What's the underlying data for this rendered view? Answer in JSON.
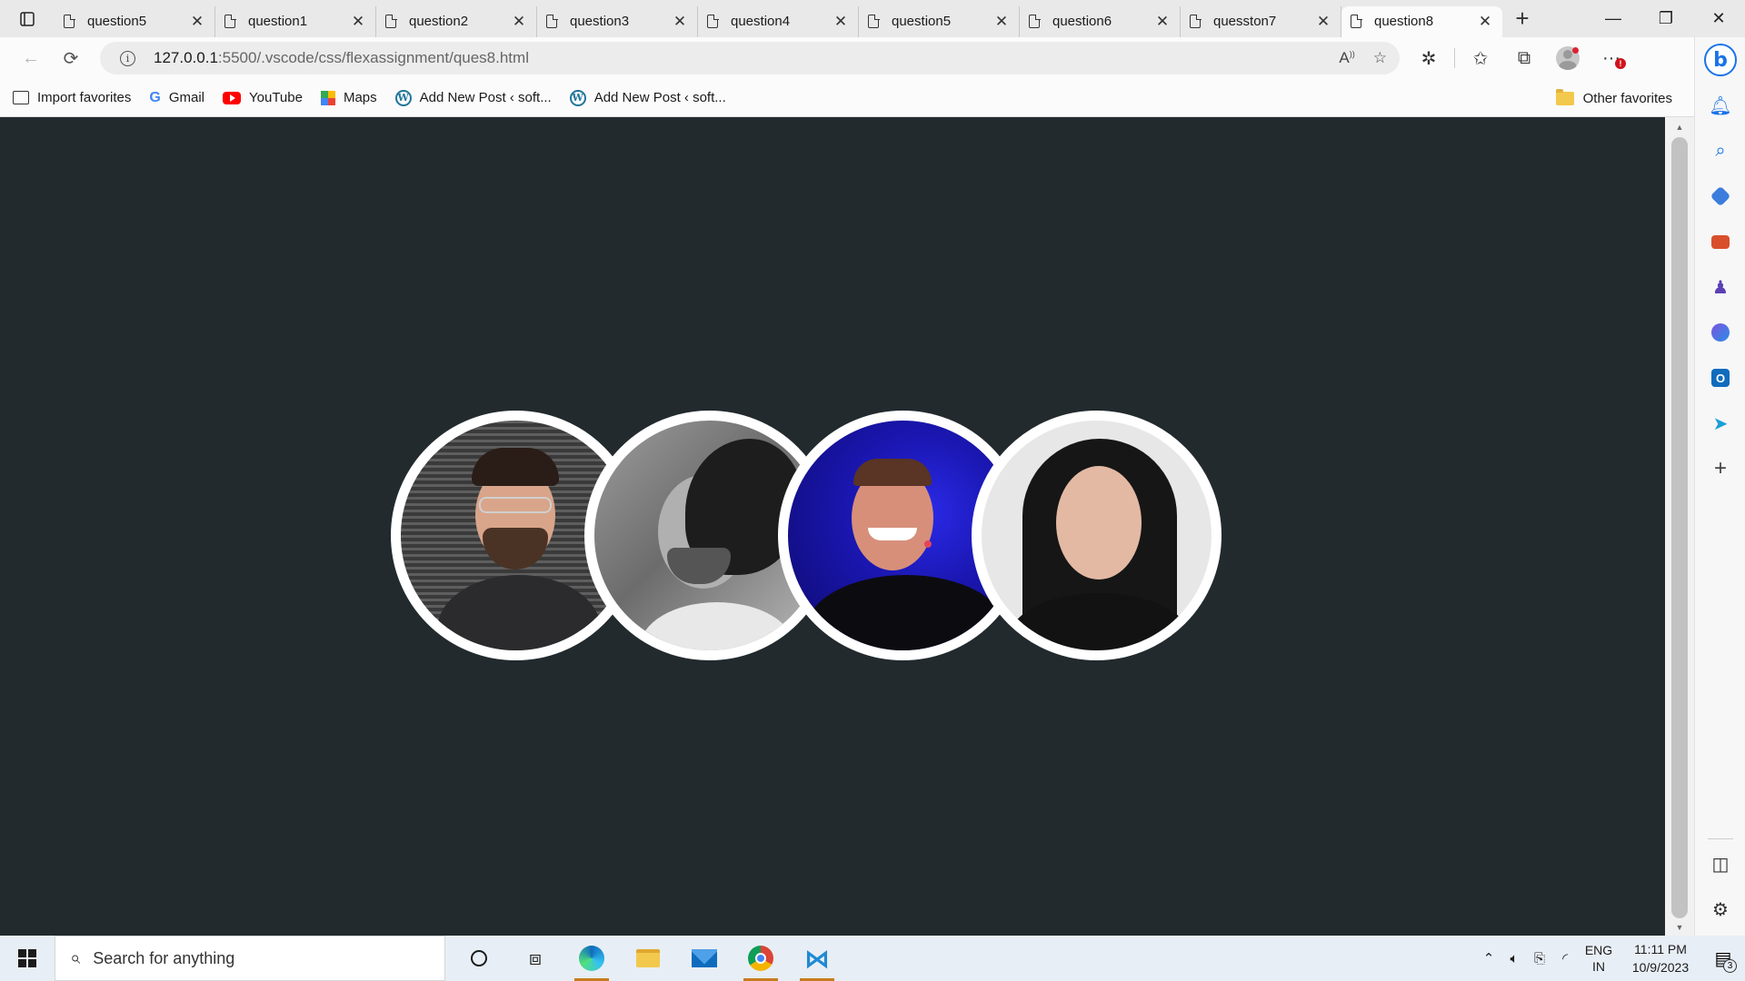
{
  "tabs": [
    {
      "label": "question5",
      "active": false
    },
    {
      "label": "question1",
      "active": false
    },
    {
      "label": "question2",
      "active": false
    },
    {
      "label": "question3",
      "active": false
    },
    {
      "label": "question4",
      "active": false
    },
    {
      "label": "question5",
      "active": false
    },
    {
      "label": "question6",
      "active": false
    },
    {
      "label": "quesston7",
      "active": false
    },
    {
      "label": "question8",
      "active": true
    }
  ],
  "tab_close_glyph": "✕",
  "new_tab_glyph": "+",
  "window_controls": {
    "minimize": "—",
    "restore": "❐",
    "close": "✕"
  },
  "address": {
    "host": "127.0.0.1",
    "path": ":5500/.vscode/css/flexassignment/ques8.html",
    "info_glyph": "i"
  },
  "favorites": [
    {
      "label": "Import favorites",
      "icon": "import-icon"
    },
    {
      "label": "Gmail",
      "icon": "google-icon"
    },
    {
      "label": "YouTube",
      "icon": "youtube-icon"
    },
    {
      "label": "Maps",
      "icon": "maps-icon"
    },
    {
      "label": "Add New Post ‹ soft...",
      "icon": "wordpress-icon"
    },
    {
      "label": "Add New Post ‹ soft...",
      "icon": "wordpress-icon"
    }
  ],
  "other_favorites": "Other favorites",
  "page": {
    "background": "#222a2e",
    "avatars": [
      {
        "name": "avatar-glasses-man",
        "style": "striped-wall"
      },
      {
        "name": "avatar-bw-curly-man",
        "style": "black-and-white"
      },
      {
        "name": "avatar-smiling-speaker",
        "style": "blue-stage"
      },
      {
        "name": "avatar-dark-hair-woman",
        "style": "light-background"
      }
    ],
    "avatar_border": "#ffffff"
  },
  "taskbar": {
    "search_placeholder": "Search for anything",
    "lang_top": "ENG",
    "lang_bottom": "IN",
    "time": "11:11 PM",
    "date": "10/9/2023",
    "notification_count": "3"
  },
  "accent_colors": {
    "edge_blue": "#1a73e8",
    "running_indicator": "#c77b1f",
    "youtube_red": "#ff0000"
  }
}
